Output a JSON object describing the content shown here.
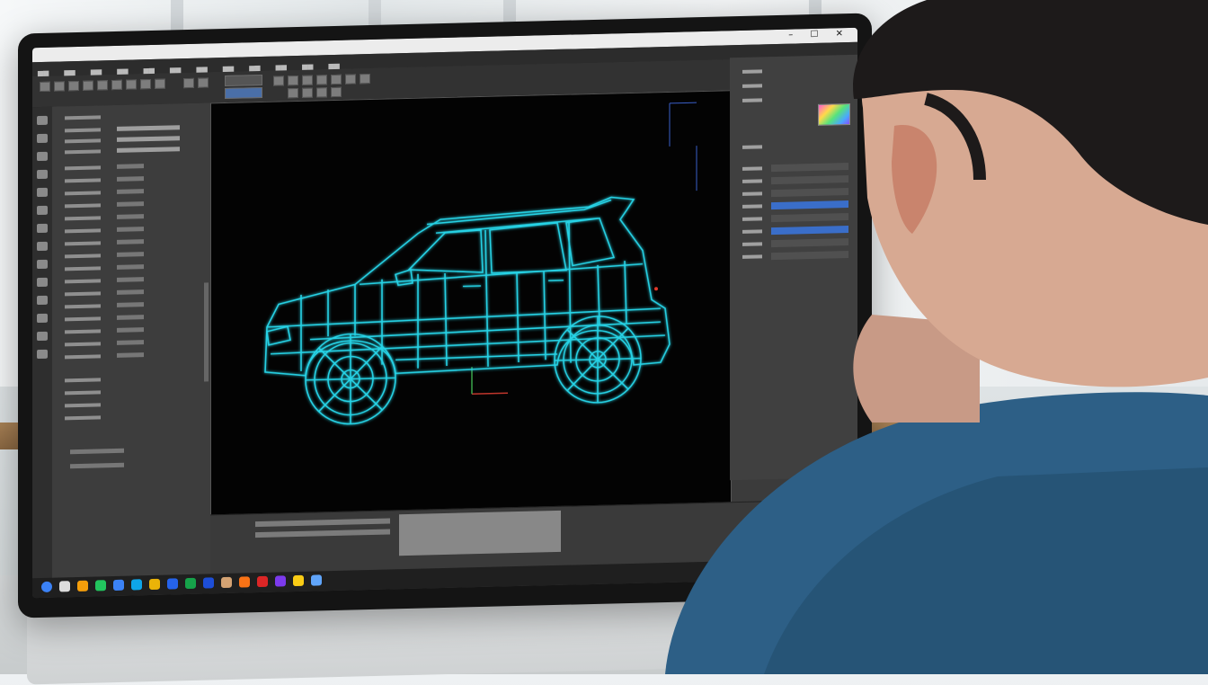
{
  "scene": {
    "description_colors": {
      "viewport_background": "#030303",
      "wireframe": "#27d3e6",
      "panel": "#3d3d3d",
      "selection_accent": "#3a6ec9"
    }
  },
  "window": {
    "controls_glyphs": "– ☐ ✕"
  },
  "icons": {
    "minimize": "minimize-icon",
    "maximize": "maximize-icon",
    "close": "close-icon"
  },
  "viewport": {
    "subject": "car-wireframe"
  }
}
